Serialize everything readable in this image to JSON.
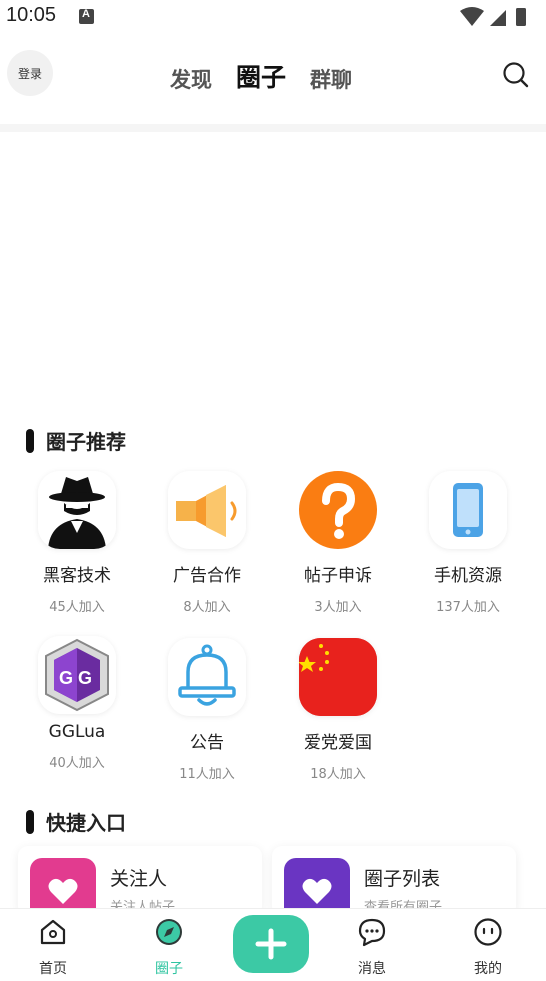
{
  "status_bar": {
    "time": "10:05"
  },
  "header": {
    "login_label": "登录",
    "tabs": [
      {
        "label": "发现",
        "active": false
      },
      {
        "label": "圈子",
        "active": true
      },
      {
        "label": "群聊",
        "active": false
      }
    ]
  },
  "sections": {
    "recommend_title": "圈子推荐",
    "shortcut_title": "快捷入口"
  },
  "circles": [
    {
      "name": "黑客技术",
      "count": "45人加入",
      "icon": "hacker-icon"
    },
    {
      "name": "广告合作",
      "count": "8人加入",
      "icon": "megaphone-icon"
    },
    {
      "name": "帖子申诉",
      "count": "3人加入",
      "icon": "question-icon"
    },
    {
      "name": "手机资源",
      "count": "137人加入",
      "icon": "phone-icon"
    },
    {
      "name": "GGLua",
      "count": "40人加入",
      "icon": "gg-logo-icon"
    },
    {
      "name": "公告",
      "count": "11人加入",
      "icon": "bell-icon"
    },
    {
      "name": "爱党爱国",
      "count": "18人加入",
      "icon": "china-flag-icon"
    }
  ],
  "shortcuts": [
    {
      "title": "关注人",
      "subtitle": "关注人帖子",
      "color": "#e23b8f"
    },
    {
      "title": "圈子列表",
      "subtitle": "查看所有圈子",
      "color": "#6a35c2"
    }
  ],
  "bottom_nav": [
    {
      "label": "首页",
      "active": false
    },
    {
      "label": "圈子",
      "active": true
    },
    {
      "label": "消息",
      "active": false
    },
    {
      "label": "我的",
      "active": false
    }
  ],
  "colors": {
    "accent": "#3cc9a5",
    "accent_text": "#2ec4a0"
  }
}
